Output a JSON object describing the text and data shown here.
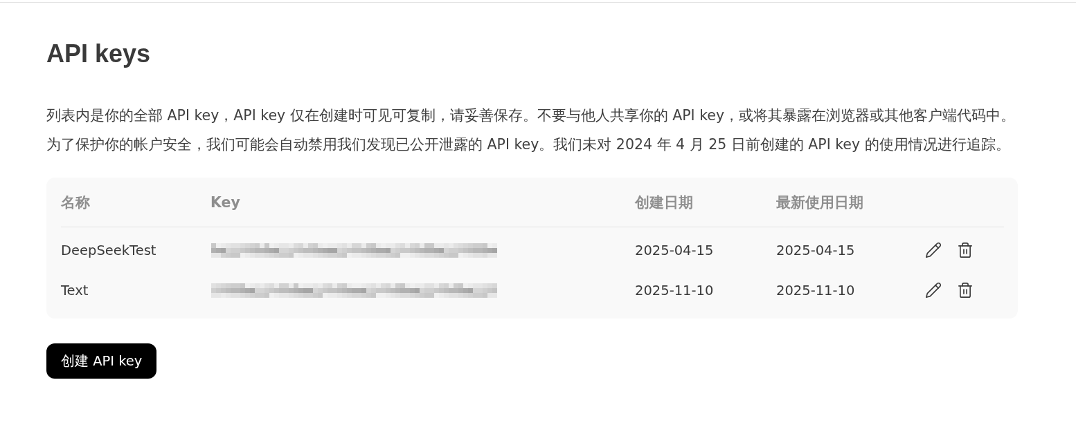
{
  "page": {
    "title": "API keys",
    "description": [
      "列表内是你的全部 API key，API key 仅在创建时可见可复制，请妥善保存。不要与他人共享你的 API key，或将其暴露在浏览器或其他客户端代码中。",
      "为了保护你的帐户安全，我们可能会自动禁用我们发现已公开泄露的 API key。我们未对 2024 年 4 月 25 日前创建的 API key 的使用情况进行追踪。"
    ]
  },
  "table": {
    "columns": [
      "名称",
      "Key",
      "创建日期",
      "最新使用日期"
    ],
    "rows": [
      {
        "name": "DeepSeekTest",
        "created": "2025-04-15",
        "last_used": "2025-04-15"
      },
      {
        "name": "Text",
        "created": "2025-11-10",
        "last_used": "2025-11-10"
      }
    ]
  },
  "create_button": {
    "label": "创建 API key"
  }
}
